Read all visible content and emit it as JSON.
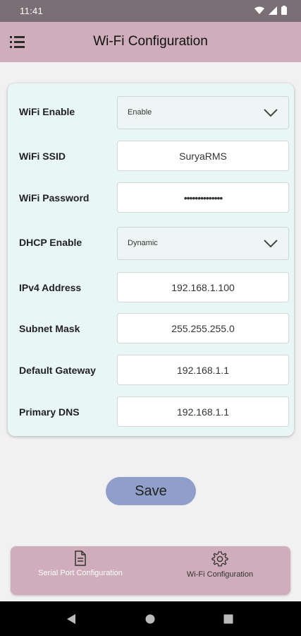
{
  "status_bar": {
    "time": "11:41"
  },
  "app_bar": {
    "title": "Wi-Fi Configuration"
  },
  "form": {
    "wifi_enable": {
      "label": "WiFi Enable",
      "value": "Enable"
    },
    "wifi_ssid": {
      "label": "WiFi SSID",
      "value": "SuryaRMS"
    },
    "wifi_password": {
      "label": "WiFi Password",
      "value": "••••••••••••••"
    },
    "dhcp_enable": {
      "label": "DHCP Enable",
      "value": "Dynamic"
    },
    "ipv4_address": {
      "label": "IPv4 Address",
      "value": "192.168.1.100"
    },
    "subnet_mask": {
      "label": "Subnet Mask",
      "value": "255.255.255.0"
    },
    "default_gateway": {
      "label": "Default Gateway",
      "value": "192.168.1.1"
    },
    "primary_dns": {
      "label": "Primary DNS",
      "value": "192.168.1.1"
    }
  },
  "save_label": "Save",
  "bottom_nav": {
    "items": [
      {
        "label": "Serial Port Configuration",
        "icon": "document-icon"
      },
      {
        "label": "Wi-Fi Configuration",
        "icon": "gear-icon"
      }
    ]
  },
  "colors": {
    "app_bar": "#cfadbb",
    "card": "#e8f7f6",
    "save_button": "#8f9fc9",
    "status_bar": "#7a6f74"
  }
}
